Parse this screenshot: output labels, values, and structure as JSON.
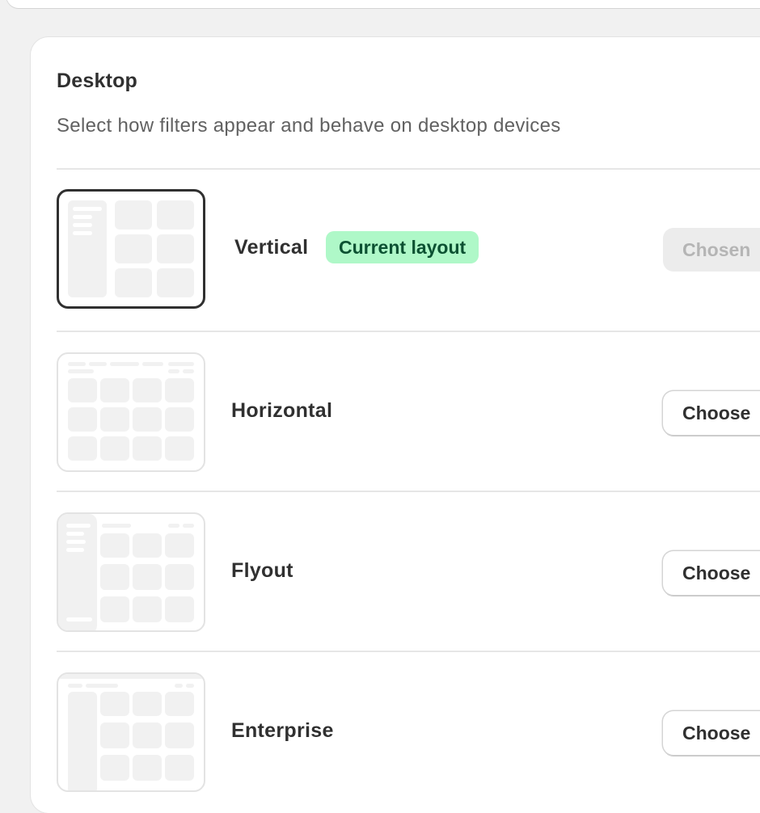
{
  "section": {
    "title": "Desktop",
    "subtitle": "Select how filters appear and behave on desktop devices"
  },
  "icons": {
    "collapse": "chevron-up-icon"
  },
  "layouts": [
    {
      "name": "Vertical",
      "badge": "Current layout",
      "button": "Chosen",
      "selected": true
    },
    {
      "name": "Horizontal",
      "button": "Choose",
      "selected": false
    },
    {
      "name": "Flyout",
      "button": "Choose",
      "selected": false
    },
    {
      "name": "Enterprise",
      "button": "Choose",
      "selected": false
    }
  ],
  "colors": {
    "badge_bg": "#aff8c8",
    "badge_text": "#0c5132",
    "selected_border": "#303030",
    "placeholder": "#f1f1f1"
  }
}
